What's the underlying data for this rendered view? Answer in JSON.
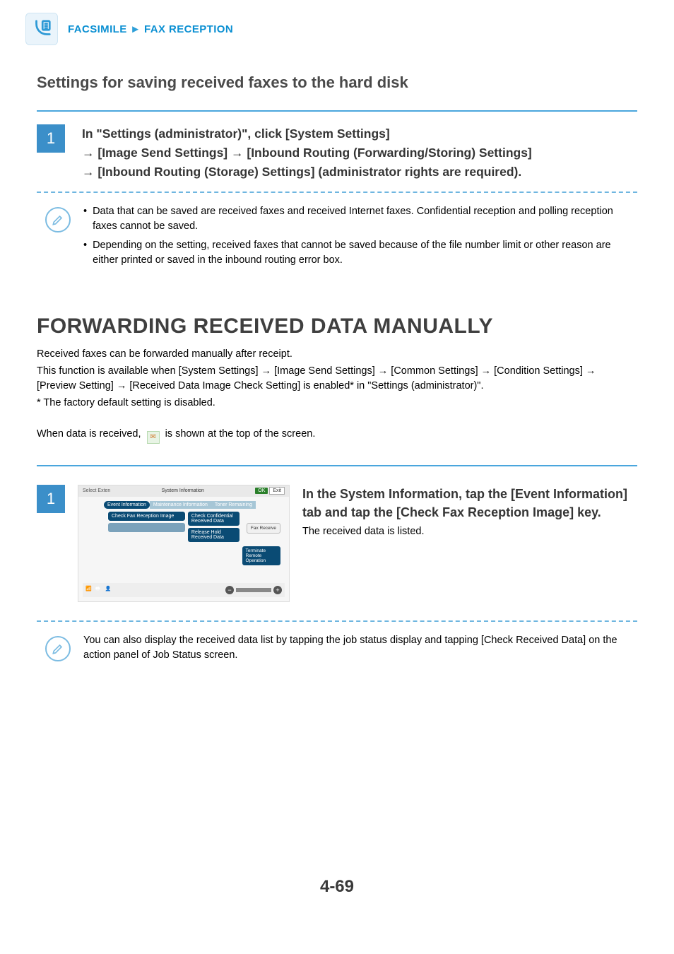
{
  "header": {
    "section": "FACSIMILE",
    "subsection": "FAX RECEPTION"
  },
  "s1": {
    "title": "Settings for saving received faxes to the hard disk",
    "step_num": "1",
    "step_l1": "In \"Settings (administrator)\", click [System Settings] ",
    "step_l2": "→ [Image Send Settings] → [Inbound Routing (Forwarding/Storing) Settings] ",
    "step_l3": "→ [Inbound Routing (Storage) Settings] (administrator rights are required).",
    "note1": "Data that can be saved are received faxes and received Internet faxes. Confidential reception and polling reception faxes cannot be saved.",
    "note2": "Depending on the setting, received faxes that cannot be saved because of the file number limit or other reason are either printed or saved in the inbound routing error box."
  },
  "s2": {
    "title": "FORWARDING RECEIVED DATA MANUALLY",
    "p1": "Received faxes can be forwarded manually after receipt.",
    "p2": "This function is available when [System Settings] → [Image Send Settings] → [Common Settings] → [Condition Settings] → [Preview Setting] → [Received Data Image Check Setting] is enabled* in \"Settings (administrator)\".",
    "p3": "* The factory default setting is disabled.",
    "p4a": "When data is received, ",
    "p4b": " is shown at the top of the screen.",
    "step_num": "1",
    "step_head": "In the System Information, tap the [Event Information] tab and tap the [Check Fax Reception Image] key.",
    "step_sub": "The received data is listed.",
    "note": "You can also display the received data list by tapping the job status display and tapping [Check Received Data] on the action panel of Job Status screen."
  },
  "screenshot": {
    "topbar_left": "Select Exten",
    "topbar_title": "System Information",
    "ok": "OK",
    "exit": "Exit",
    "tab1": "Event Information",
    "tab2": "Maintenance Information",
    "tab3": "Toner Remaining",
    "btn1": "Check Fax Reception Image",
    "btn2": "Check Confidential Received Data",
    "btn3": "Release Hold Received Data",
    "right1": "Fax Receive",
    "right2": "Terminate Remote Operation"
  },
  "page_number": "4-69"
}
